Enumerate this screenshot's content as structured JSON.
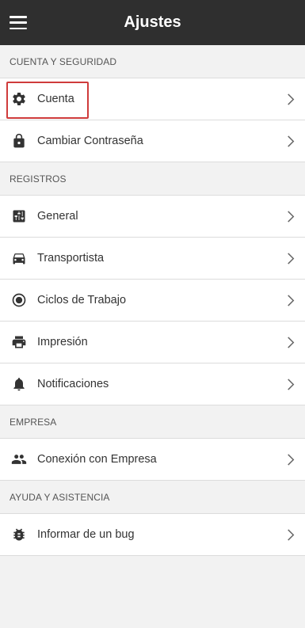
{
  "header": {
    "title": "Ajustes",
    "menu_icon": "hamburger-menu-icon"
  },
  "sections": [
    {
      "title": "CUENTA Y SEGURIDAD",
      "items": [
        {
          "label": "Cuenta",
          "icon": "gear-icon"
        },
        {
          "label": "Cambiar Contraseña",
          "icon": "lock-icon"
        }
      ]
    },
    {
      "title": "REGISTROS",
      "items": [
        {
          "label": "General",
          "icon": "sliders-icon"
        },
        {
          "label": "Transportista",
          "icon": "car-icon"
        },
        {
          "label": "Ciclos de Trabajo",
          "icon": "radio-circle-icon"
        },
        {
          "label": "Impresión",
          "icon": "printer-icon"
        },
        {
          "label": "Notificaciones",
          "icon": "bell-icon"
        }
      ]
    },
    {
      "title": "EMPRESA",
      "items": [
        {
          "label": "Conexión con Empresa",
          "icon": "people-icon"
        }
      ]
    },
    {
      "title": "AYUDA Y ASISTENCIA",
      "items": [
        {
          "label": "Informar de un bug",
          "icon": "bug-icon"
        }
      ]
    }
  ],
  "colors": {
    "header_bg": "#2f2f2f",
    "highlight_border": "#cf3b3b",
    "page_bg": "#f2f2f2"
  }
}
